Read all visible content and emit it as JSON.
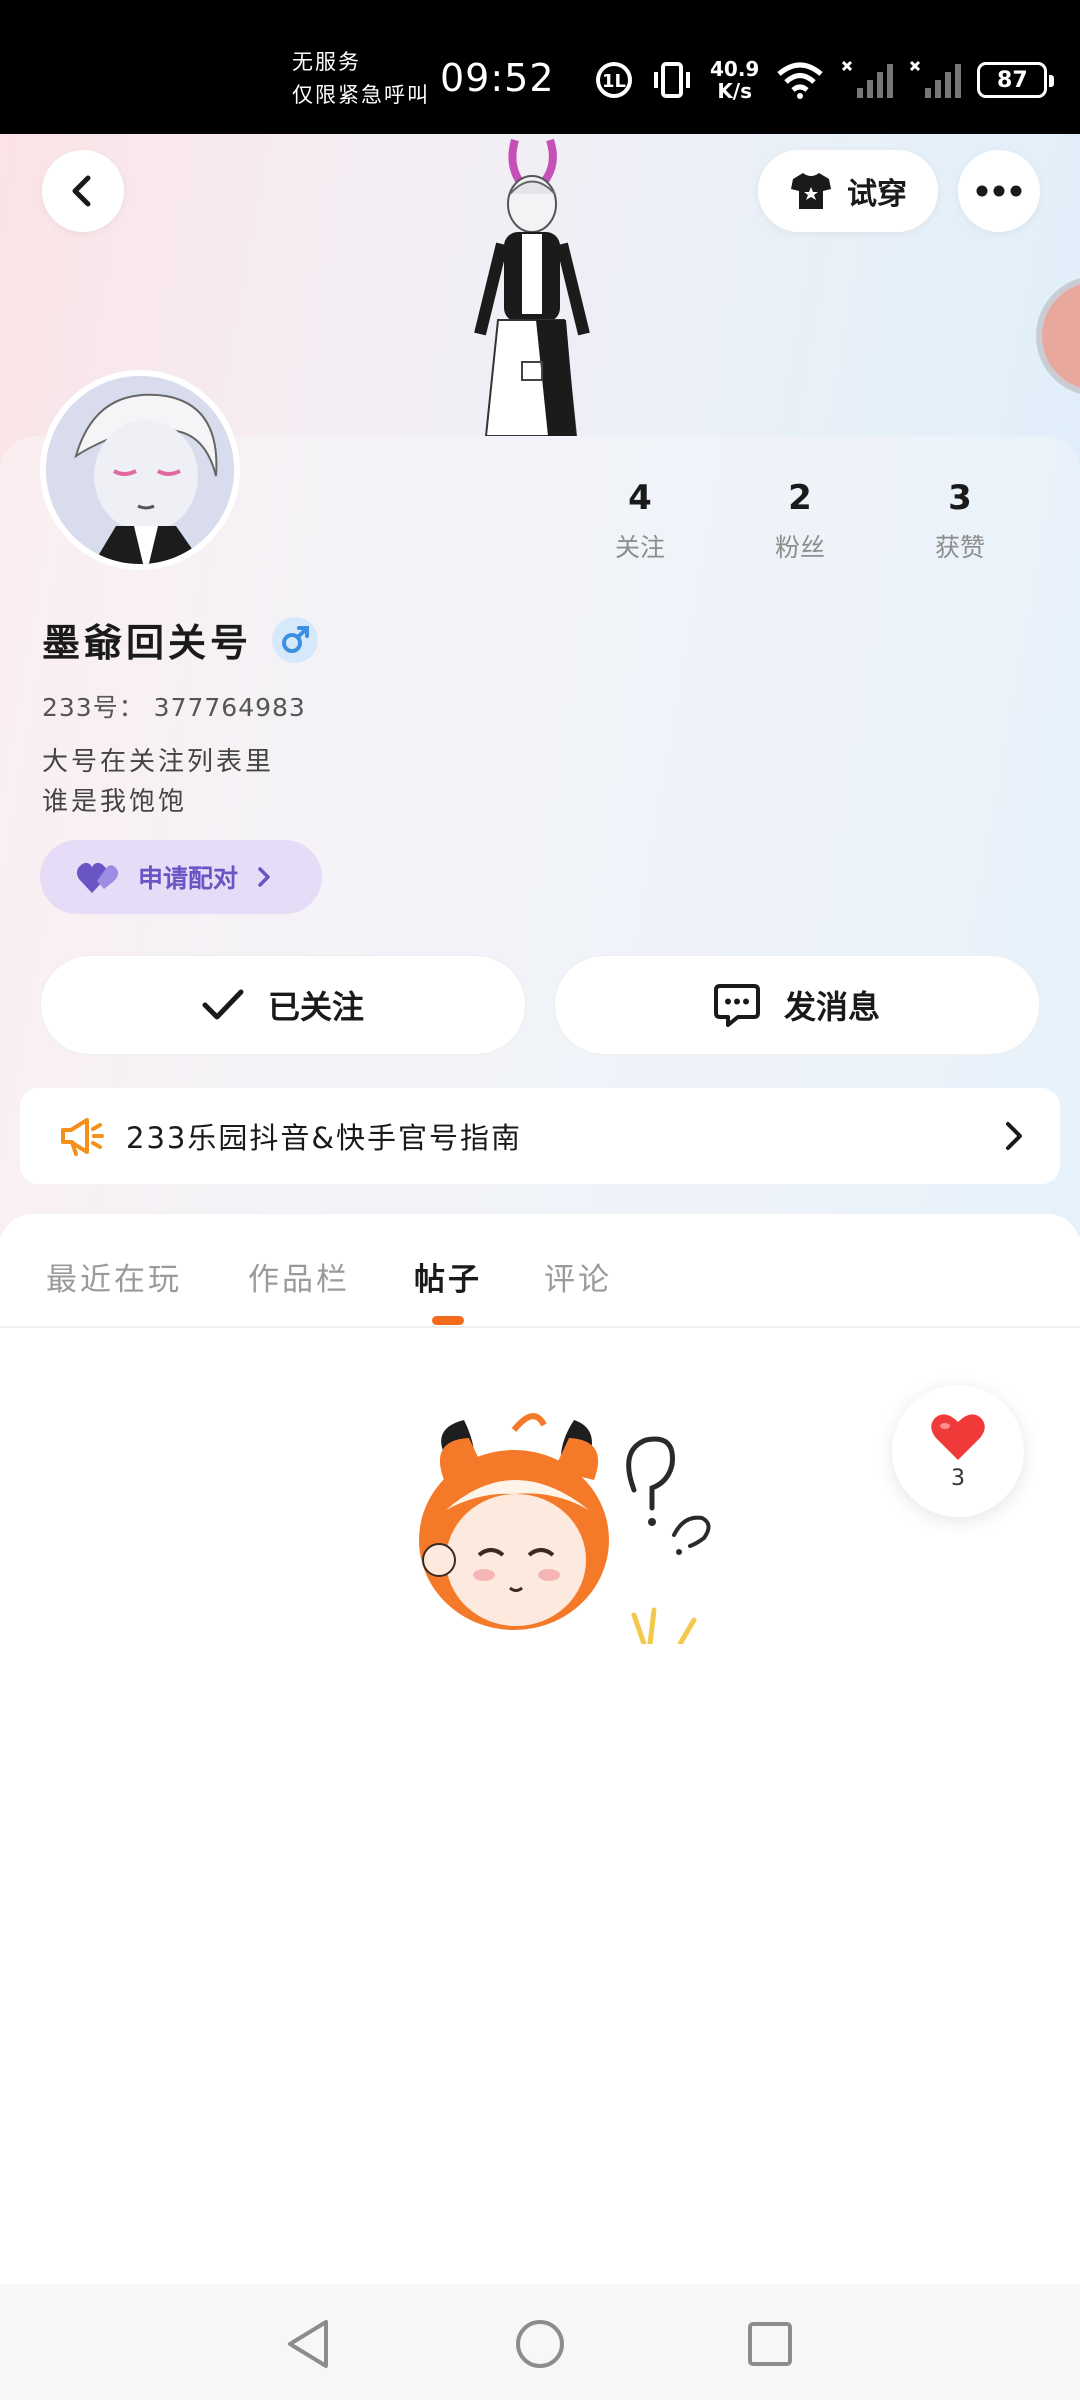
{
  "status_bar": {
    "carrier_line1": "无服务",
    "carrier_line2": "仅限紧急呼叫",
    "time": "09:52",
    "network_speed_value": "40.9",
    "network_speed_unit": "K/s",
    "battery": "87"
  },
  "header": {
    "back_icon": "chevron-left-icon",
    "try_on_label": "试穿",
    "more_icon": "more-horizontal-icon"
  },
  "profile": {
    "username": "墨爺回关号",
    "gender": "male",
    "uid_label": "233号：",
    "uid_value": "377764983",
    "bio_line1": "大号在关注列表里",
    "bio_line2": "谁是我饱饱",
    "match_label": "申请配对",
    "stats": [
      {
        "value": "4",
        "label": "关注"
      },
      {
        "value": "2",
        "label": "粉丝"
      },
      {
        "value": "3",
        "label": "获赞"
      }
    ]
  },
  "actions": {
    "follow_label": "已关注",
    "message_label": "发消息"
  },
  "notice": {
    "text": "233乐园抖音&快手官号指南"
  },
  "tabs": [
    {
      "label": "最近在玩",
      "active": false
    },
    {
      "label": "作品栏",
      "active": false
    },
    {
      "label": "帖子",
      "active": true
    },
    {
      "label": "评论",
      "active": false
    }
  ],
  "like_float": {
    "count": "3"
  },
  "colors": {
    "accent_orange": "#f26a1b",
    "match_purple": "#6a55c4",
    "match_bg": "#e6dcf7",
    "gender_blue": "#3d8fe0",
    "heart_red": "#f03a3a"
  }
}
